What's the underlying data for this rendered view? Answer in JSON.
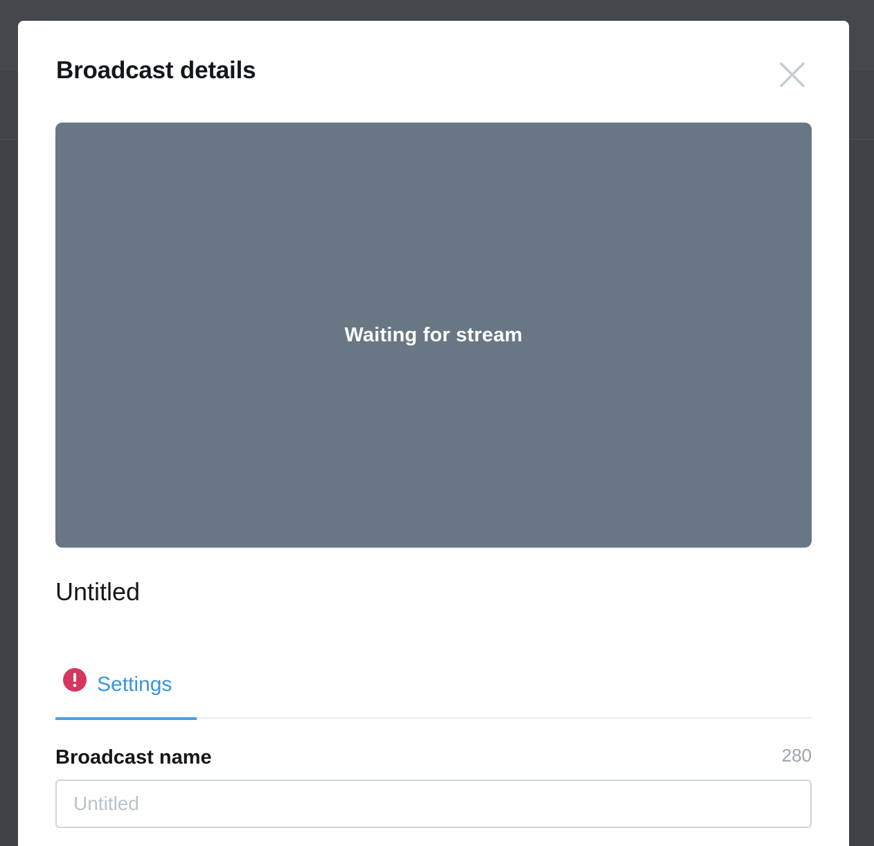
{
  "modal": {
    "title": "Broadcast details"
  },
  "video": {
    "status": "Waiting for stream"
  },
  "broadcast": {
    "title": "Untitled"
  },
  "tabs": [
    {
      "label": "Settings",
      "active": true,
      "alert": true,
      "icon": "alert-icon"
    }
  ],
  "form": {
    "name_label": "Broadcast name",
    "name_counter": "280",
    "name_placeholder": "Untitled",
    "name_value": ""
  },
  "colors": {
    "video_bg": "#697684",
    "accent": "#3b94df",
    "alert": "#d4365f",
    "overlay": "#3f4246"
  }
}
